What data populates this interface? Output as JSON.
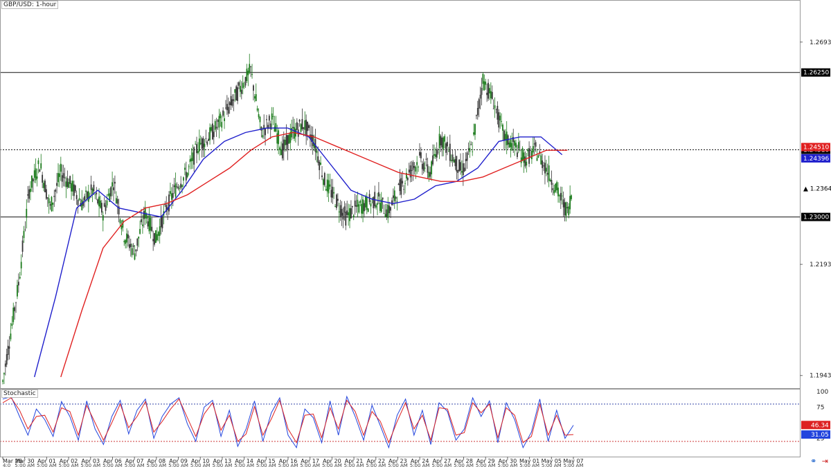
{
  "window": {
    "title": "GBP/USD: 1-hour"
  },
  "icons": {
    "link": "link-icon",
    "arrow": "arrow-right-icon"
  },
  "colors": {
    "sma_fast": "#1f1fcc",
    "sma_slow": "#e02020",
    "bull": "#1a7a1a",
    "bear": "#333333",
    "stoch_main": "#2244dd",
    "stoch_signal": "#dd2222"
  },
  "chart_data": [
    {
      "type": "candlestick",
      "title": "GBP/USD: 1-hour",
      "ylim": [
        1.1915,
        1.2788
      ],
      "y_ticks": [
        "1.26934",
        "1.21934",
        "1.19434"
      ],
      "x_labels": [
        "Mar 26",
        "Mar 30",
        "Apr 01",
        "Apr 02",
        "Apr 03",
        "Apr 06",
        "Apr 07",
        "Apr 08",
        "Apr 09",
        "Apr 10",
        "Apr 13",
        "Apr 14",
        "Apr 15",
        "Apr 16",
        "Apr 17",
        "Apr 20",
        "Apr 21",
        "Apr 22",
        "Apr 23",
        "Apr 24",
        "Apr 27",
        "Apr 28",
        "Apr 29",
        "Apr 30",
        "May 01",
        "May 05",
        "May 07"
      ],
      "x_sublabels": [
        "5:00 AM"
      ],
      "first_sublabel": "4:0",
      "horizontal_lines": [
        {
          "price": 1.2625,
          "label": "1.26250",
          "style": "solid"
        },
        {
          "price": 1.2451,
          "label": "1.24510",
          "style": "dotted"
        },
        {
          "price": 1.23,
          "label": "1.23000",
          "style": "solid"
        }
      ],
      "current_price": {
        "price": 1.2364,
        "label": "1.23640"
      },
      "price_path": [
        [
          0,
          1.193
        ],
        [
          3,
          1.215
        ],
        [
          5,
          1.236
        ],
        [
          7,
          1.242
        ],
        [
          9,
          1.232
        ],
        [
          11,
          1.24
        ],
        [
          13,
          1.237
        ],
        [
          15,
          1.233
        ],
        [
          17,
          1.236
        ],
        [
          19,
          1.231
        ],
        [
          21,
          1.238
        ],
        [
          23,
          1.226
        ],
        [
          25,
          1.222
        ],
        [
          27,
          1.231
        ],
        [
          29,
          1.225
        ],
        [
          31,
          1.232
        ],
        [
          33,
          1.237
        ],
        [
          35,
          1.24
        ],
        [
          37,
          1.246
        ],
        [
          39,
          1.248
        ],
        [
          41,
          1.251
        ],
        [
          43,
          1.255
        ],
        [
          45,
          1.259
        ],
        [
          47,
          1.263
        ],
        [
          49,
          1.249
        ],
        [
          51,
          1.252
        ],
        [
          53,
          1.245
        ],
        [
          55,
          1.249
        ],
        [
          57,
          1.251
        ],
        [
          59,
          1.247
        ],
        [
          61,
          1.238
        ],
        [
          63,
          1.234
        ],
        [
          65,
          1.23
        ],
        [
          67,
          1.232
        ],
        [
          69,
          1.233
        ],
        [
          71,
          1.234
        ],
        [
          73,
          1.231
        ],
        [
          75,
          1.236
        ],
        [
          77,
          1.24
        ],
        [
          79,
          1.243
        ],
        [
          81,
          1.24
        ],
        [
          83,
          1.248
        ],
        [
          85,
          1.244
        ],
        [
          87,
          1.24
        ],
        [
          89,
          1.246
        ],
        [
          91,
          1.261
        ],
        [
          93,
          1.256
        ],
        [
          95,
          1.248
        ],
        [
          97,
          1.246
        ],
        [
          99,
          1.243
        ],
        [
          101,
          1.245
        ],
        [
          103,
          1.241
        ],
        [
          105,
          1.236
        ],
        [
          107,
          1.231
        ],
        [
          108,
          1.2364
        ]
      ],
      "series": [
        {
          "values": [
            [
              6,
              1.194
            ],
            [
              10,
              1.212
            ],
            [
              14,
              1.232
            ],
            [
              18,
              1.236
            ],
            [
              22,
              1.232
            ],
            [
              26,
              1.231
            ],
            [
              30,
              1.23
            ],
            [
              34,
              1.236
            ],
            [
              38,
              1.243
            ],
            [
              42,
              1.247
            ],
            [
              46,
              1.249
            ],
            [
              50,
              1.25
            ],
            [
              54,
              1.25
            ],
            [
              58,
              1.248
            ],
            [
              62,
              1.242
            ],
            [
              66,
              1.236
            ],
            [
              70,
              1.234
            ],
            [
              74,
              1.233
            ],
            [
              78,
              1.234
            ],
            [
              82,
              1.237
            ],
            [
              86,
              1.238
            ],
            [
              90,
              1.241
            ],
            [
              94,
              1.247
            ],
            [
              98,
              1.248
            ],
            [
              102,
              1.248
            ],
            [
              106,
              1.244
            ]
          ]
        },
        {
          "values": [
            [
              11,
              1.194
            ],
            [
              15,
              1.209
            ],
            [
              19,
              1.223
            ],
            [
              23,
              1.229
            ],
            [
              27,
              1.232
            ],
            [
              31,
              1.233
            ],
            [
              35,
              1.235
            ],
            [
              39,
              1.238
            ],
            [
              43,
              1.241
            ],
            [
              47,
              1.245
            ],
            [
              51,
              1.248
            ],
            [
              55,
              1.249
            ],
            [
              59,
              1.248
            ],
            [
              63,
              1.246
            ],
            [
              67,
              1.244
            ],
            [
              71,
              1.242
            ],
            [
              75,
              1.24
            ],
            [
              79,
              1.239
            ],
            [
              83,
              1.238
            ],
            [
              87,
              1.238
            ],
            [
              91,
              1.239
            ],
            [
              95,
              1.241
            ],
            [
              99,
              1.243
            ],
            [
              103,
              1.245
            ],
            [
              107,
              1.245
            ]
          ]
        }
      ],
      "series_labels": [
        "1.24396",
        "1.24510"
      ]
    },
    {
      "type": "line",
      "title": "Stochastic",
      "ylim": [
        0,
        100
      ],
      "y_ticks": [
        "100",
        "75",
        "25"
      ],
      "levels": [
        80,
        20
      ],
      "value_labels": [
        "46.34",
        "31.05"
      ],
      "series": [
        {
          "values": [
            88,
            92,
            60,
            30,
            72,
            55,
            28,
            84,
            60,
            22,
            85,
            40,
            15,
            60,
            86,
            32,
            70,
            88,
            25,
            60,
            80,
            90,
            48,
            20,
            75,
            86,
            28,
            70,
            12,
            40,
            85,
            20,
            66,
            90,
            30,
            10,
            72,
            58,
            18,
            85,
            30,
            92,
            60,
            22,
            78,
            45,
            10,
            62,
            88,
            30,
            70,
            15,
            82,
            68,
            22,
            40,
            90,
            60,
            85,
            18,
            82,
            55,
            10,
            35,
            88,
            20,
            70,
            25,
            46
          ]
        },
        {
          "values": [
            82,
            90,
            70,
            40,
            60,
            62,
            35,
            74,
            68,
            30,
            78,
            50,
            22,
            50,
            80,
            42,
            60,
            84,
            35,
            52,
            72,
            88,
            58,
            28,
            64,
            82,
            38,
            62,
            20,
            32,
            76,
            30,
            56,
            86,
            40,
            18,
            62,
            64,
            26,
            74,
            40,
            86,
            68,
            30,
            68,
            52,
            18,
            52,
            82,
            40,
            62,
            22,
            74,
            72,
            30,
            34,
            82,
            66,
            80,
            26,
            74,
            62,
            18,
            28,
            80,
            30,
            62,
            30,
            31
          ]
        }
      ]
    }
  ]
}
